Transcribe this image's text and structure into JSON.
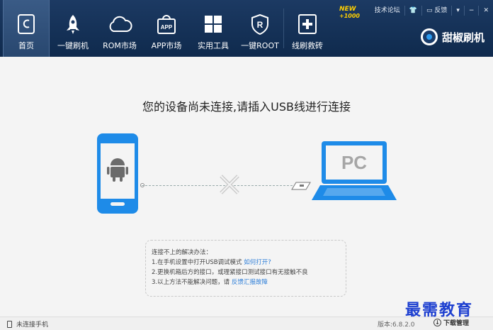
{
  "nav": {
    "items": [
      {
        "label": "首页",
        "icon": "home-c-icon"
      },
      {
        "label": "一键刷机",
        "icon": "rocket-icon"
      },
      {
        "label": "ROM市场",
        "icon": "cloud-icon"
      },
      {
        "label": "APP市场",
        "icon": "app-bag-icon"
      },
      {
        "label": "实用工具",
        "icon": "grid-icon"
      },
      {
        "label": "一键ROOT",
        "icon": "root-shield-icon"
      },
      {
        "label": "线刷救砖",
        "icon": "rescue-icon"
      }
    ],
    "badge_new": "NEW",
    "badge_count": "+1000"
  },
  "window": {
    "forum": "技术论坛",
    "feedback": "反馈",
    "minimize": "−",
    "close": "✕",
    "menu": "▾"
  },
  "brand": {
    "name": "甜椒刷机"
  },
  "main": {
    "headline": "您的设备尚未连接,请插入USB线进行连接",
    "pc_label": "PC",
    "help": {
      "title": "连接不上的解决办法：",
      "line1": "1.在手机设置中打开USB调试模式",
      "line1_link": "如何打开?",
      "line2": "2.更换机箱后方的接口，或理紧接口测试接口有无接触不良",
      "line3": "3.以上方法不能解决问题，请",
      "line3_link": "反馈汇报故障"
    }
  },
  "status": {
    "device": "未连接手机",
    "version": "版本:6.8.2.0",
    "download": "下载管理"
  },
  "watermark": "最需教育",
  "colors": {
    "topbar": "#163357",
    "accent": "#1e8be8",
    "link": "#2f7fd8"
  }
}
